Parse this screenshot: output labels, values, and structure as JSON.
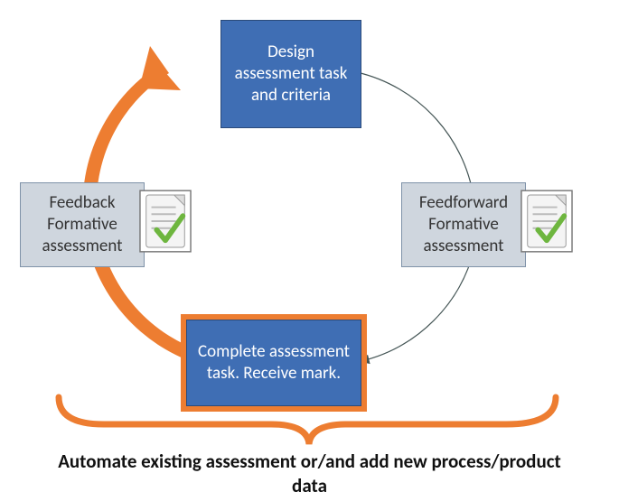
{
  "diagram": {
    "nodes": {
      "design": {
        "label": "Design assessment task and criteria"
      },
      "feedforward": {
        "label": "Feedforward Formative assessment",
        "icon": "document-check-icon"
      },
      "complete": {
        "label": "Complete assessment task. Receive mark."
      },
      "feedback": {
        "label": "Feedback Formative assessment",
        "icon": "document-check-icon"
      }
    },
    "caption": "Automate existing assessment or/and add new process/product data",
    "flow": [
      "design",
      "feedforward",
      "complete",
      "feedback",
      "design"
    ],
    "loop_style": {
      "left_half": "orange-thick-arrow",
      "right_half": "thin-arrow"
    },
    "bracket": {
      "spans": [
        "complete",
        "feedforward"
      ],
      "points_to": "caption"
    },
    "colors": {
      "orange": "#ed7d31",
      "blue_fill": "#3f6eb4",
      "gray_fill": "#cfd6de"
    }
  }
}
